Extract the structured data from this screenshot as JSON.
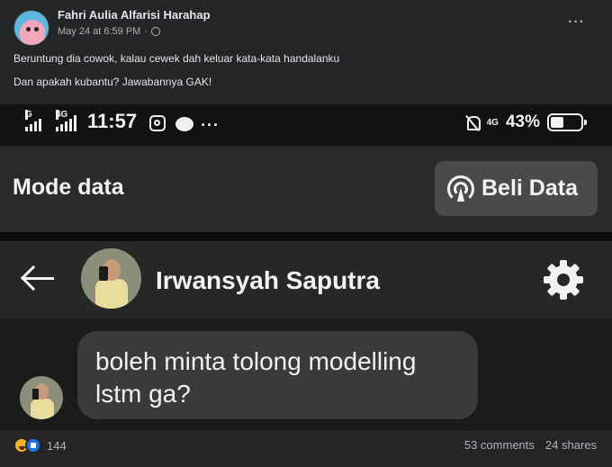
{
  "post": {
    "author": "Fahri Aulia Alfarisi Harahap",
    "date": "May 24 at 6:59 PM",
    "separator": "·",
    "more": "···",
    "text_line1": "Beruntung dia cowok, kalau cewek dah keluar kata-kata handalanku",
    "text_line2": "Dan apakah kubantu? Jawabannya GAK!"
  },
  "screenshot": {
    "status": {
      "sim1_label": "G",
      "sim2_label": "4G",
      "time": "11:57",
      "more": "···",
      "network": "4G",
      "battery_pct": "43%",
      "battery_level": 0.43
    },
    "mode_data_label": "Mode data",
    "beli_data_label": "Beli Data",
    "contact_name": "Irwansyah Saputra",
    "message": "boleh minta tolong modelling lstm ga?"
  },
  "footer": {
    "reaction_count": "144",
    "comments": "53 comments",
    "shares": "24 shares"
  },
  "colors": {
    "background": "#242526",
    "like_blue": "#1b74e4",
    "haha_yellow": "#f7b125"
  }
}
